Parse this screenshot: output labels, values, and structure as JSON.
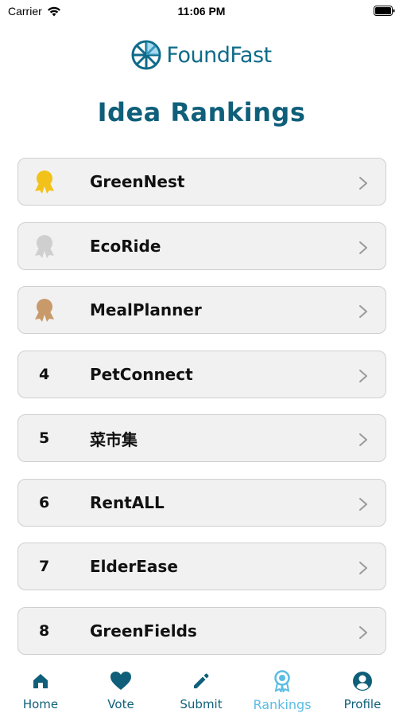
{
  "status_bar": {
    "carrier": "Carrier",
    "time": "11:06 PM"
  },
  "logo": {
    "text": "FoundFast",
    "icon": "compass-wheel-logo"
  },
  "page_title": "Idea Rankings",
  "rankings": [
    {
      "rank_display": "",
      "medal": "gold-medal-icon",
      "name": "GreenNest"
    },
    {
      "rank_display": "",
      "medal": "silver-medal-icon",
      "name": "EcoRide"
    },
    {
      "rank_display": "",
      "medal": "bronze-medal-icon",
      "name": "MealPlanner"
    },
    {
      "rank_display": "4",
      "medal": "",
      "name": "PetConnect"
    },
    {
      "rank_display": "5",
      "medal": "",
      "name": "菜市集"
    },
    {
      "rank_display": "6",
      "medal": "",
      "name": "RentALL"
    },
    {
      "rank_display": "7",
      "medal": "",
      "name": "ElderEase"
    },
    {
      "rank_display": "8",
      "medal": "",
      "name": "GreenFields"
    }
  ],
  "colors": {
    "gold": "#f2c21b",
    "silver": "#cfcfcf",
    "bronze": "#c89a6a",
    "brand": "#0f5f7a",
    "active_tab": "#5bbce4"
  },
  "tabs": [
    {
      "label": "Home",
      "icon": "home-icon",
      "active": false
    },
    {
      "label": "Vote",
      "icon": "heart-icon",
      "active": false
    },
    {
      "label": "Submit",
      "icon": "pencil-icon",
      "active": false
    },
    {
      "label": "Rankings",
      "icon": "award-icon",
      "active": true
    },
    {
      "label": "Profile",
      "icon": "profile-icon",
      "active": false
    }
  ]
}
